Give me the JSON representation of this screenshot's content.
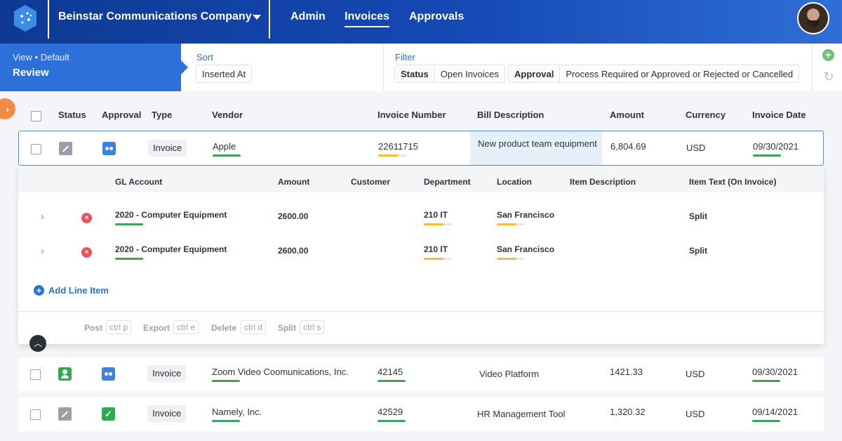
{
  "header": {
    "company": "Beinstar Communications Company",
    "nav": [
      "Admin",
      "Invoices",
      "Approvals"
    ],
    "active_nav": "Invoices"
  },
  "viewbar": {
    "view_small": "View • Default",
    "view_name": "Review",
    "sort_label": "Sort",
    "sort_value": "Inserted At",
    "filter_label": "Filter",
    "filters": [
      {
        "key": "Status",
        "value": "Open Invoices"
      },
      {
        "key": "Approval",
        "value": "Process Required or Approved or Rejected or Cancelled"
      }
    ]
  },
  "table": {
    "columns": [
      "Status",
      "Approval",
      "Type",
      "Vendor",
      "Invoice Number",
      "Bill Description",
      "Amount",
      "Currency",
      "Invoice Date"
    ],
    "rows": [
      {
        "type": "Invoice",
        "vendor": "Apple",
        "invoice_number": "22611715",
        "bill_description": "New product team equipment",
        "amount": "6,804.69",
        "currency": "USD",
        "invoice_date": "09/30/2021",
        "status_icon": "edit-icon",
        "approval_icon": "pending-approval-icon"
      },
      {
        "type": "Invoice",
        "vendor": "Zoom Video Coomunications, Inc.",
        "invoice_number": "42145",
        "bill_description": "Video Platform",
        "amount": "1421.33",
        "currency": "USD",
        "invoice_date": "09/30/2021",
        "status_icon": "user-icon",
        "approval_icon": "pending-approval-icon"
      },
      {
        "type": "Invoice",
        "vendor": "Namely, Inc.",
        "invoice_number": "42529",
        "bill_description": "HR Management Tool",
        "amount": "1,320.32",
        "currency": "USD",
        "invoice_date": "09/14/2021",
        "status_icon": "edit-icon",
        "approval_icon": "check-icon"
      }
    ]
  },
  "lines": {
    "columns": [
      "GL Account",
      "Amount",
      "Customer",
      "Department",
      "Location",
      "Item Description",
      "Item Text (On Invoice)"
    ],
    "items": [
      {
        "gl_account": "2020 - Computer Equipment",
        "amount": "2600.00",
        "customer": "",
        "department": "210 IT",
        "location": "San Francisco",
        "item_description": "",
        "item_text": "Split"
      },
      {
        "gl_account": "2020 - Computer Equipment",
        "amount": "2600.00",
        "customer": "",
        "department": "210 IT",
        "location": "San Francisco",
        "item_description": "",
        "item_text": "Split"
      }
    ],
    "add_label": "Add Line Item",
    "actions": [
      {
        "label": "Post",
        "shortcut": "ctrl p"
      },
      {
        "label": "Export",
        "shortcut": "ctrl e"
      },
      {
        "label": "Delete",
        "shortcut": "ctrl d"
      },
      {
        "label": "Split",
        "shortcut": "ctrl s"
      }
    ]
  },
  "colors": {
    "brand": "#1549b5",
    "accent": "#2d70d9",
    "success": "#2eaa4f",
    "warning": "#f2c037",
    "danger": "#e9535a"
  }
}
